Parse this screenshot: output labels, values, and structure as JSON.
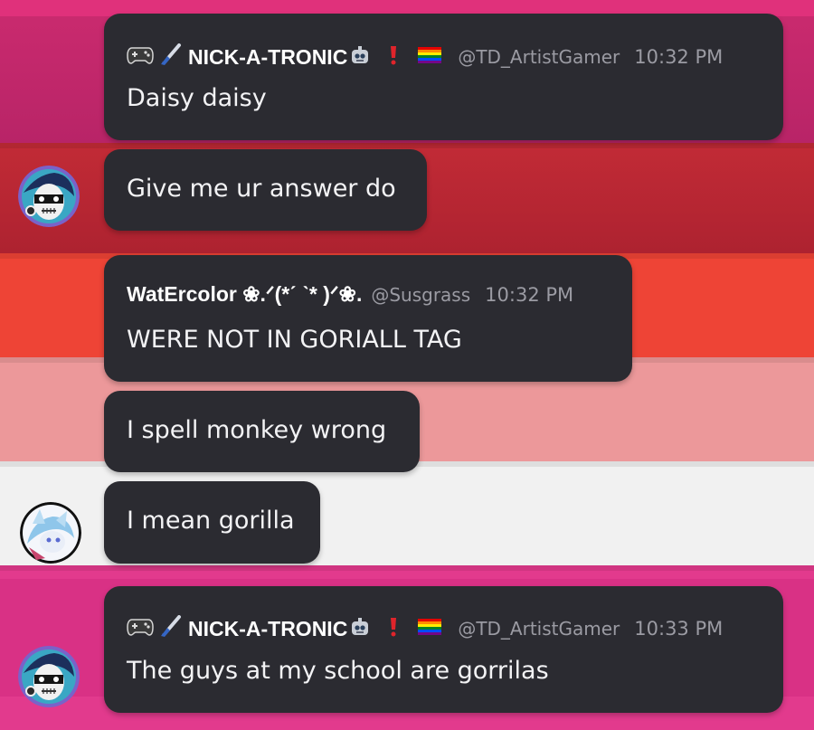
{
  "messages": [
    {
      "username": "NICK-A-TRONIC",
      "handle": "@TD_ArtistGamer",
      "time": "10:32 PM",
      "text": "Daisy daisy"
    },
    {
      "text": "Give me ur answer do"
    },
    {
      "username": "WatErcolor ❀.ᐟ(*ˊ ˋ* )ᐟ❀.",
      "handle": "@Susgrass",
      "time": "10:32 PM",
      "text": "WERE NOT IN GORIALL TAG"
    },
    {
      "text": "I spell monkey wrong"
    },
    {
      "text": "I mean gorilla"
    },
    {
      "username": "NICK-A-TRONIC",
      "handle": "@TD_ArtistGamer",
      "time": "10:33 PM",
      "text": "The guys at my school are gorrilas"
    }
  ],
  "icons": {
    "controller": "controller-icon",
    "brush": "paintbrush-icon",
    "robot": "robot-icon",
    "exclamation": "exclamation-icon",
    "flag": "rainbow-flag-icon"
  },
  "colors": {
    "bubble": "#2b2b31",
    "text": "#f3f3f5",
    "muted": "#9b9ba3",
    "exclamation": "#e0242b"
  }
}
